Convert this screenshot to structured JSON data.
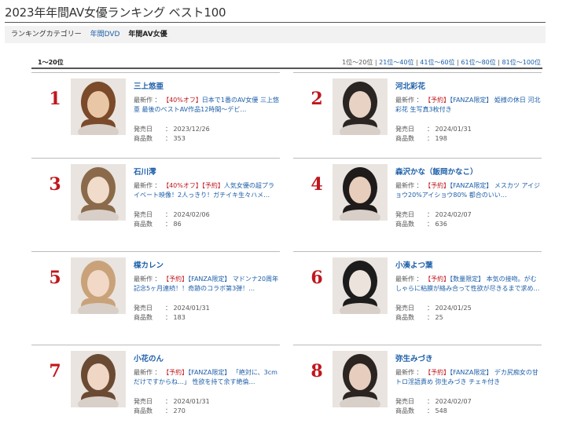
{
  "page": {
    "title": "2023年年間AV女優ランキング ベスト100"
  },
  "category": {
    "label": "ランキングカテゴリー",
    "links": [
      "年間DVD"
    ],
    "current": "年間AV女優"
  },
  "range": {
    "current": "1～20位",
    "pager_current": "1位～20位",
    "pager_links": [
      "21位～40位",
      "41位～60位",
      "61位～80位",
      "81位～100位"
    ],
    "separator": " | "
  },
  "labels": {
    "latest": "最新作",
    "release": "発売日",
    "count": "商品数",
    "colon": "："
  },
  "entries": [
    {
      "rank": "1",
      "name": "三上悠亜",
      "tags": [
        "【40%オフ】"
      ],
      "title": "日本で1番のAV女優 三上悠亜 最後のベストAV作品12時間～デビ…",
      "release": "2023/12/26",
      "count": "353"
    },
    {
      "rank": "2",
      "name": "河北彩花",
      "tags": [
        "【予約】"
      ],
      "title": "【FANZA限定】 姫様の休日 河北彩花 生写真3枚付き",
      "release": "2024/01/31",
      "count": "198"
    },
    {
      "rank": "3",
      "name": "石川澪",
      "tags": [
        "【40%オフ】",
        "【予約】"
      ],
      "title": "人気女優の超プライベート映像！2人っきり！ガチイキ生々ハメ…",
      "release": "2024/02/06",
      "count": "86"
    },
    {
      "rank": "4",
      "name": "森沢かな（飯岡かなこ）",
      "tags": [
        "【予約】"
      ],
      "title": "【FANZA限定】 メスカツ アイジョウ20%アイショウ80% 都合のいい…",
      "release": "2024/02/07",
      "count": "636"
    },
    {
      "rank": "5",
      "name": "楪カレン",
      "tags": [
        "【予約】"
      ],
      "title": "【FANZA限定】 マドンナ20周年記念5ヶ月連続！！奇跡のコラボ第3弾！…",
      "release": "2024/01/31",
      "count": "183"
    },
    {
      "rank": "6",
      "name": "小湊よつ葉",
      "tags": [
        "【予約】"
      ],
      "title": "【数量限定】 本気の接吻。がむしゃらに粘膜が絡み合って性欲が尽きるまで求め…",
      "release": "2024/01/25",
      "count": "25"
    },
    {
      "rank": "7",
      "name": "小花のん",
      "tags": [
        "【予約】"
      ],
      "title": "【FANZA限定】 「絶対に、3cmだけですからね…」 性欲を持て余す絶倫…",
      "release": "2024/01/31",
      "count": "270"
    },
    {
      "rank": "8",
      "name": "弥生みづき",
      "tags": [
        "【予約】"
      ],
      "title": "【FANZA限定】 デカ尻痴女の甘トロ淫語責め 弥生みづき チェキ付き",
      "release": "2024/02/07",
      "count": "548"
    }
  ],
  "colors": {
    "accent_red": "#c0171d",
    "link_blue": "#1c5ea8"
  }
}
